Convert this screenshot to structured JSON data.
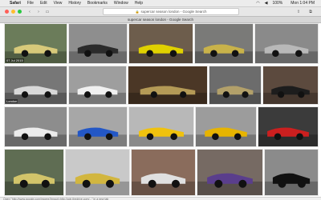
{
  "menubar": {
    "apple": "",
    "items": [
      "Safari",
      "File",
      "Edit",
      "View",
      "History",
      "Bookmarks",
      "Window",
      "Help"
    ],
    "status_icons": [
      "wifi-icon",
      "volume-icon"
    ],
    "battery": "100%",
    "clock": "Mon 1:04 PM"
  },
  "toolbar": {
    "address": "supercar season london - Google Search"
  },
  "tab": {
    "title": "supercar season london - Google Search"
  },
  "status": {
    "text": "Open \"http://www.google.com/imgres?imgurl=http://cdn.thedrive.com/...\" in a new tab"
  },
  "images": [
    {
      "caption": "07 Jul 2015",
      "bg": "#6b7c5a",
      "car": "#d7c97a"
    },
    {
      "caption": "",
      "bg": "#8e8e8e",
      "car": "#2b2b2b"
    },
    {
      "caption": "",
      "bg": "#6d5d4c",
      "car": "#e0d100"
    },
    {
      "caption": "",
      "bg": "#7a7a78",
      "car": "#c8b24a"
    },
    {
      "caption": "",
      "bg": "#8a8a8a",
      "car": "#b8b8b8"
    },
    {
      "caption": "London",
      "bg": "#777",
      "car": "#d8d8d8"
    },
    {
      "caption": "",
      "bg": "#9e9e9e",
      "car": "#f0f0f0"
    },
    {
      "caption": "",
      "bg": "#4b3726",
      "car": "#b49a56"
    },
    {
      "caption": "",
      "bg": "#6c6c6c",
      "car": "#b2a06a"
    },
    {
      "caption": "",
      "bg": "#5c4a3e",
      "car": "#1d1d1d"
    },
    {
      "caption": "",
      "bg": "#8d8d8d",
      "car": "#ececec"
    },
    {
      "caption": "",
      "bg": "#a7a7a7",
      "car": "#2357c6"
    },
    {
      "caption": "",
      "bg": "#b8b8b8",
      "car": "#f0c20e"
    },
    {
      "caption": "",
      "bg": "#9c9c9c",
      "car": "#e7b400"
    },
    {
      "caption": "",
      "bg": "#3b3b3b",
      "car": "#cc1f1f"
    },
    {
      "caption": "",
      "bg": "#5f6d53",
      "car": "#d2c46a"
    },
    {
      "caption": "",
      "bg": "#c9c9c9",
      "car": "#d2b63f"
    },
    {
      "caption": "",
      "bg": "#8a6c5c",
      "car": "#e0e0e0"
    },
    {
      "caption": "",
      "bg": "#766a63",
      "car": "#5a3e8c"
    },
    {
      "caption": "",
      "bg": "#8b8b8b",
      "car": "#111111"
    }
  ]
}
